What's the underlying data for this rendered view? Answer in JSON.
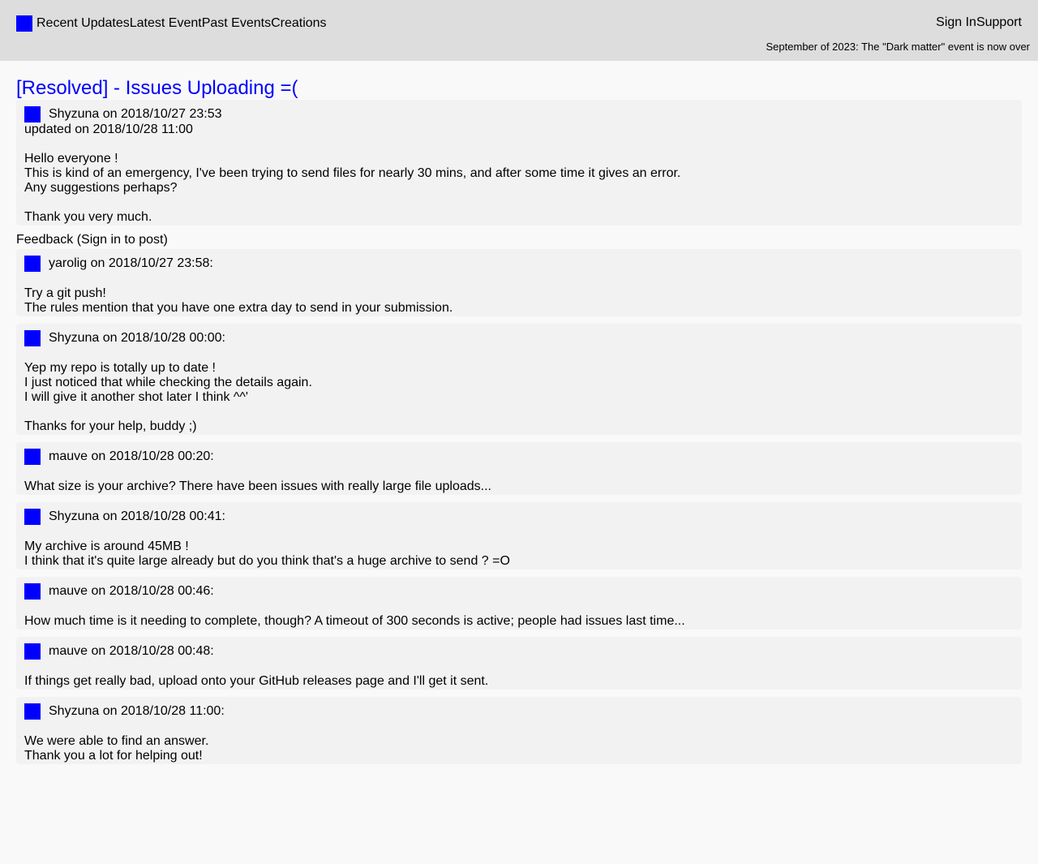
{
  "nav": {
    "links": [
      "Recent Updates",
      "Latest Event",
      "Past Events",
      "Creations"
    ],
    "sign_in": "Sign In",
    "support": "Support",
    "banner": "September of 2023: The \"Dark matter\" event is now over"
  },
  "thread": {
    "title": "[Resolved] - Issues Uploading =(",
    "author_line": "Shyzuna on 2018/10/27 23:53",
    "updated_line": "updated on 2018/10/28 11:00",
    "paragraphs": [
      [
        "Hello everyone !",
        "This is kind of an emergency, I've been trying to send files for nearly 30 mins, and after some time it gives an error.",
        "Any suggestions perhaps?"
      ],
      [
        "Thank you very much."
      ]
    ]
  },
  "feedback": {
    "label": "Feedback (Sign in to post)"
  },
  "comments": [
    {
      "author_line": "yarolig on 2018/10/27 23:58:",
      "paragraphs": [
        [
          "Try a git push!",
          "The rules mention that you have one extra day to send in your submission."
        ]
      ]
    },
    {
      "author_line": "Shyzuna on 2018/10/28 00:00:",
      "paragraphs": [
        [
          "Yep my repo is totally up to date !",
          "I just noticed that while checking the details again.",
          "I will give it another shot later I think ^^'"
        ],
        [
          "Thanks for your help, buddy ;)"
        ]
      ]
    },
    {
      "author_line": "mauve on 2018/10/28 00:20:",
      "paragraphs": [
        [
          "What size is your archive? There have been issues with really large file uploads..."
        ]
      ]
    },
    {
      "author_line": "Shyzuna on 2018/10/28 00:41:",
      "paragraphs": [
        [
          "My archive is around 45MB !",
          "I think that it's quite large already but do you think that's a huge archive to send ? =O"
        ]
      ]
    },
    {
      "author_line": "mauve on 2018/10/28 00:46:",
      "paragraphs": [
        [
          "How much time is it needing to complete, though? A timeout of 300 seconds is active; people had issues last time..."
        ]
      ]
    },
    {
      "author_line": "mauve on 2018/10/28 00:48:",
      "paragraphs": [
        [
          "If things get really bad, upload onto your GitHub releases page and I'll get it sent."
        ]
      ]
    },
    {
      "author_line": "Shyzuna on 2018/10/28 11:00:",
      "paragraphs": [
        [
          "We were able to find an answer.",
          "Thank you a lot for helping out!"
        ]
      ]
    }
  ],
  "colors": {
    "accent": "#0000ff",
    "topbar": "#dddddd",
    "card": "#f2f2f2",
    "page": "#f9f9f9"
  }
}
